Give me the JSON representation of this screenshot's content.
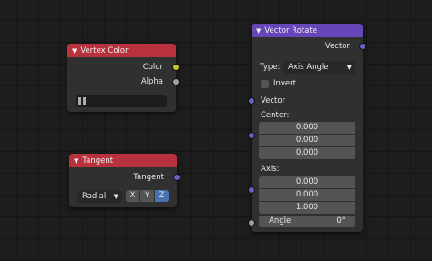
{
  "vertex_color": {
    "title": "Vertex Color",
    "outputs": [
      "Color",
      "Alpha"
    ],
    "layer_value": ""
  },
  "tangent": {
    "title": "Tangent",
    "output": "Tangent",
    "direction": "Radial",
    "axes": [
      "X",
      "Y",
      "Z"
    ],
    "active_axis": "Z"
  },
  "vector_rotate": {
    "title": "Vector Rotate",
    "output": "Vector",
    "type_label": "Type:",
    "type_value": "Axis Angle",
    "invert_label": "Invert",
    "vector_label": "Vector",
    "center_label": "Center:",
    "center": [
      "0.000",
      "0.000",
      "0.000"
    ],
    "axis_label": "Axis:",
    "axis": [
      "0.000",
      "0.000",
      "1.000"
    ],
    "angle_label": "Angle",
    "angle_value": "0°"
  },
  "colors": {
    "header_red": "#b8323e",
    "header_purple": "#6646b8",
    "socket_yellow": "#c7c729",
    "socket_gray": "#a1a1a1",
    "socket_blue": "#6363c7",
    "active_blue": "#4772b3"
  }
}
